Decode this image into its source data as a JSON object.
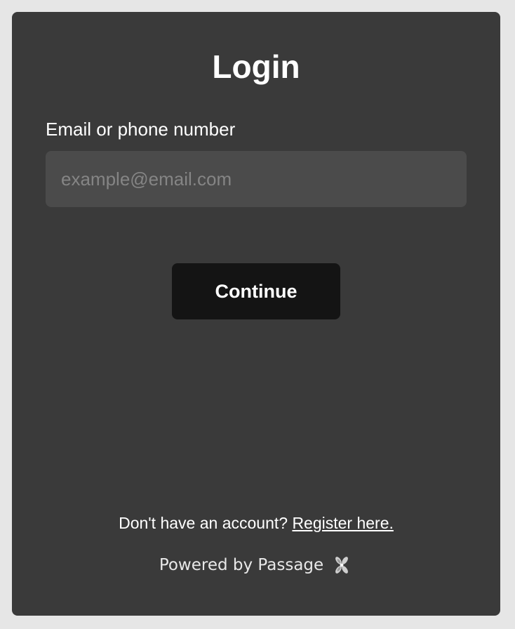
{
  "login": {
    "title": "Login",
    "email_label": "Email or phone number",
    "email_value": "",
    "email_placeholder": "example@email.com",
    "continue_label": "Continue"
  },
  "footer": {
    "register_prompt": "Don't have an account?",
    "register_link": "Register here.",
    "powered_by": "Powered by Passage",
    "logo_icon": "passage-logo-icon"
  },
  "colors": {
    "page_background": "#e6e6e6",
    "card_background": "#3a3a3a",
    "input_background": "#4b4b4b",
    "button_background": "#141414",
    "text": "#ffffff"
  }
}
